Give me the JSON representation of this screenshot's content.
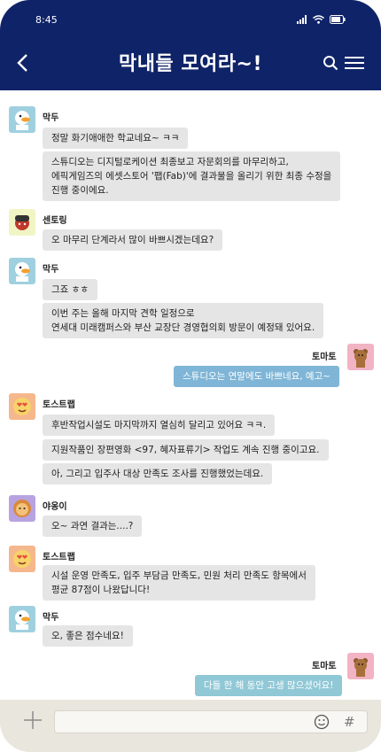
{
  "status_bar": {
    "time": "8:45"
  },
  "header": {
    "title": "막내들 모여라~!"
  },
  "messages": [
    {
      "sender": "막두",
      "lines": [
        "정말 화기애애한 학교네요~ ㅋㅋ"
      ]
    },
    {
      "sender": "막두",
      "lines": [
        "스튜디오는 디지털로케이션 최종보고 자문회의를 마무리하고,",
        "에픽게임즈의 에셋스토어 '팹(Fab)'에 결과물을 올리기 위한 최종 수정을",
        "진행 중이에요."
      ]
    },
    {
      "sender": "센토링",
      "lines": [
        "오 마무리 단계라서 많이 바쁘시겠는데요?"
      ]
    },
    {
      "sender": "막두",
      "lines": [
        "그죠 ㅎㅎ"
      ]
    },
    {
      "sender": "막두",
      "lines": [
        "이번 주는 올해 마지막 견학 일정으로",
        "연세대 미래캠퍼스와 부산 교장단 경영협의회 방문이 예정돼 있어요."
      ]
    },
    {
      "sender": "토마토",
      "lines": [
        "스튜디오는 연말에도 바쁘네요, 예고~"
      ]
    },
    {
      "sender": "토스트랩",
      "lines": [
        "후반작업시설도 마지막까지 열심히 달리고 있어요 ㅋㅋ."
      ]
    },
    {
      "sender": "토스트랩",
      "lines": [
        "지원작품인 장편영화 <97, 혜자표류기> 작업도 계속 진행 중이고요."
      ]
    },
    {
      "sender": "토스트랩",
      "lines": [
        "아, 그리고 입주사 대상 만족도 조사를 진행했었는데요."
      ]
    },
    {
      "sender": "야옹이",
      "lines": [
        "오~ 과연 결과는....?"
      ]
    },
    {
      "sender": "토스트랩",
      "lines": [
        "시설 운영 만족도, 입주 부담금 만족도, 민원 처리 만족도 항목에서",
        "평균 87점이 나왔답니다!"
      ]
    },
    {
      "sender": "막두",
      "lines": [
        "오, 좋은 점수네요!"
      ]
    },
    {
      "sender": "토마토",
      "lines": [
        "다들 한 해 동안 고생 많으셨어요!"
      ]
    }
  ],
  "icons": {
    "back": "chevron-left-icon",
    "search": "search-icon",
    "menu": "hamburger-menu-icon",
    "attach": "plus-icon",
    "emoji": "smiley-icon",
    "hashtag": "hash-icon"
  },
  "composer": {
    "hash_glyph": "#"
  },
  "colors": {
    "header": "#0f2368",
    "bubble_other": "#e5e5e5",
    "bubble_me": "#7fb5d6",
    "bubble_me_last": "#90c8d6"
  }
}
